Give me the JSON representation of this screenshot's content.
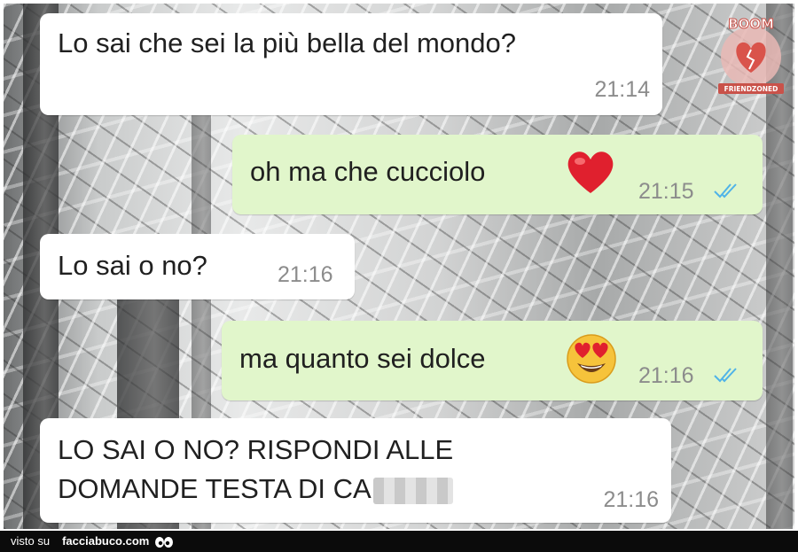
{
  "watermark": {
    "top_text": "BOOM",
    "bottom_text": "FRIENDZONED"
  },
  "messages": [
    {
      "direction": "incoming",
      "text": "Lo sai che sei la più bella del mondo?",
      "time": "21:14"
    },
    {
      "direction": "outgoing",
      "text": "oh ma che cucciolo",
      "emoji": "red-heart-icon",
      "time": "21:15",
      "status": "read"
    },
    {
      "direction": "incoming",
      "text": "Lo sai o no?",
      "time": "21:16"
    },
    {
      "direction": "outgoing",
      "text": "ma quanto sei dolce",
      "emoji": "heart-eyes-icon",
      "time": "21:16",
      "status": "read"
    },
    {
      "direction": "incoming",
      "text_line1": "LO SAI O NO? RISPONDI ALLE",
      "text_line2": "DOMANDE TESTA DI CA",
      "time": "21:16"
    }
  ],
  "footer": {
    "prefix": "visto su",
    "site": "facciabuco.com"
  },
  "colors": {
    "incoming_bubble": "#ffffff",
    "outgoing_bubble": "#e1f6cb",
    "time": "#8c8c8c",
    "tick": "#4fb3e8"
  }
}
